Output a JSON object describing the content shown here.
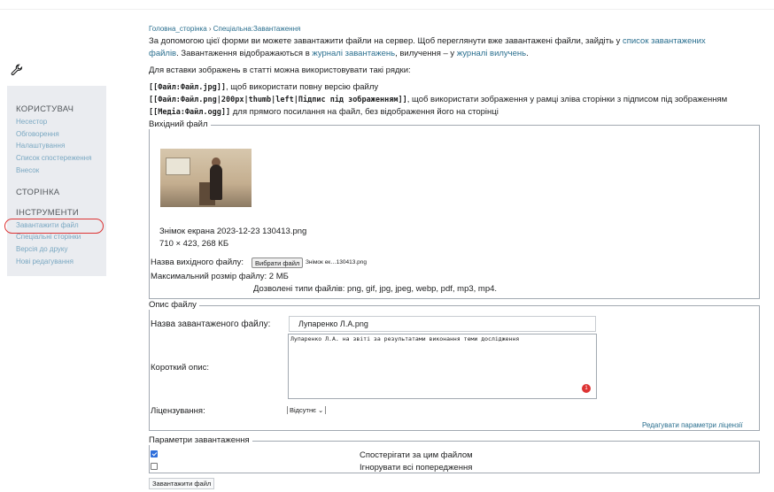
{
  "breadcrumb": {
    "home": "Головна_сторінка",
    "sep": " › ",
    "current": "Спеціальна:Завантаження"
  },
  "intro": {
    "line1_text": "За допомогою цієї форми ви можете завантажити файли на сервер. Щоб переглянути вже завантажені файли, зайдіть у ",
    "line1_link": "список завантажених",
    "line2_link": "файлів",
    "line2_text": ". Завантаження відображаються в ",
    "line2_link2": "журналі завантажень",
    "line2_text2": ", вилучення – у ",
    "line2_link3": "журналі вилучень",
    "line2_end": "."
  },
  "insert_hint": "Для вставки зображень в статті можна використовувати такі рядки:",
  "syntax": [
    {
      "code": "[[Файл:Файл.jpg]]",
      "desc": ", щоб використати повну версію файлу"
    },
    {
      "code": "[[Файл:Файл.png|200px|thumb|left|Підпис під зображенням]]",
      "desc": ", щоб використати зображення у рамці зліва сторінки з підписом під зображенням"
    },
    {
      "code": "[[Медіа:Файл.ogg]]",
      "desc": " для прямого посилання на файл, без відображення його на сторінці"
    }
  ],
  "source_section": {
    "legend": "Вихідний файл",
    "file_name": "Знімок екрана 2023-12-23 130413.png",
    "file_meta": "710 × 423, 268 КБ",
    "source_label": "Назва вихідного файлу:",
    "choose_button": "Вибрати файл",
    "chosen_file": "Знімок ек…130413.png",
    "max_size": "Максимальний розмір файлу: 2 МБ",
    "allowed_types": "Дозволені типи файлів: png, gif, jpg, jpeg, webp, pdf, mp3, mp4."
  },
  "description_section": {
    "legend": "Опис файлу",
    "dest_label": "Назва завантаженого файлу:",
    "dest_value": "Лупаренко Л.А.png",
    "summary_label": "Короткий опис:",
    "summary_value": "Лупаренко Л.А. на звіті за результатами виконання теми дослідження",
    "badge": "1",
    "license_label": "Ліцензування:",
    "license_value": "Відсутнє",
    "license_edit_link": "Редагувати параметри ліцензії"
  },
  "options_section": {
    "legend": "Параметри завантаження",
    "watch_label": "Спостерігати за цим файлом",
    "watch_checked": true,
    "ignore_label": "Ігнорувати всі попередження",
    "ignore_checked": false
  },
  "submit_label": "Завантажити файл",
  "sidebar": {
    "user_head": "КОРИСТУВАЧ",
    "user_links": [
      "Несестор",
      "Обговорення",
      "Налаштування",
      "Список спостереження",
      "Внесок"
    ],
    "page_head": "СТОРІНКА",
    "tools_head": "ІНСТРУМЕНТИ",
    "tools_links": [
      "Завантажити файл",
      "Спеціальні сторінки",
      "Версія до друку",
      "Нові редагування"
    ]
  },
  "colors": {
    "link": "#2a6f8f",
    "sidebar_bg": "#eaecf0",
    "highlight_oval": "#dd3333"
  }
}
